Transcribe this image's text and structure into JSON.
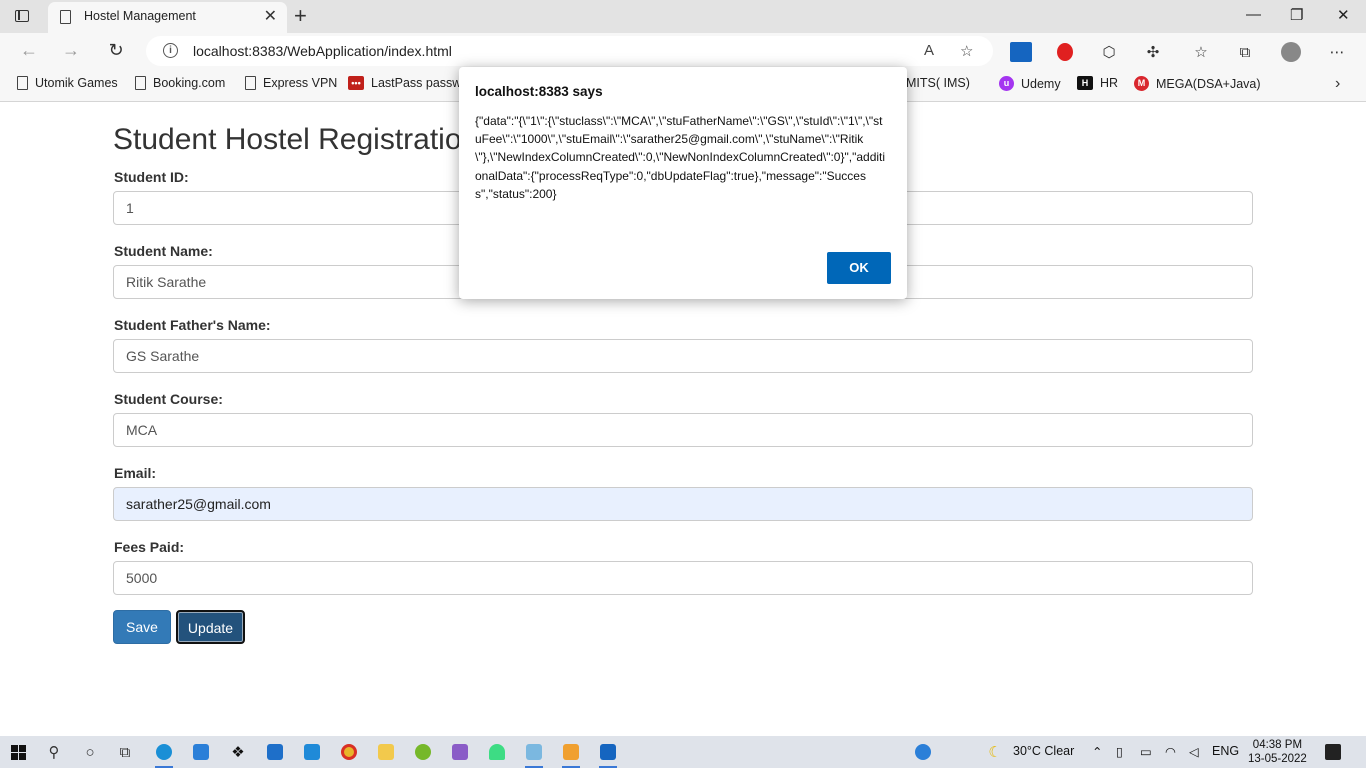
{
  "browser": {
    "tab_title": "Hostel Management",
    "url": "localhost:8383/WebApplication/index.html"
  },
  "bookmarks": [
    {
      "label": "Utomik Games"
    },
    {
      "label": "Booking.com"
    },
    {
      "label": "Express VPN"
    },
    {
      "label": "LastPass passwo"
    },
    {
      "label": "MITS( IMS)"
    },
    {
      "label": "Udemy"
    },
    {
      "label": "HR"
    },
    {
      "label": "MEGA(DSA+Java)"
    }
  ],
  "form": {
    "heading": "Student Hostel Registration",
    "student_id_label": "Student ID:",
    "student_id_value": "1",
    "student_name_label": "Student Name:",
    "student_name_value": "Ritik Sarathe",
    "father_name_label": "Student Father's Name:",
    "father_name_value": "GS Sarathe",
    "course_label": "Student Course:",
    "course_value": "MCA",
    "email_label": "Email:",
    "email_value": "sarather25@gmail.com",
    "fees_label": "Fees Paid:",
    "fees_value": "5000",
    "save_label": "Save",
    "update_label": "Update"
  },
  "dialog": {
    "title": "localhost:8383 says",
    "message": "{\"data\":\"{\\\"1\\\":{\\\"stuclass\\\":\\\"MCA\\\",\\\"stuFatherName\\\":\\\"GS\\\",\\\"stuId\\\":\\\"1\\\",\\\"stuFee\\\":\\\"1000\\\",\\\"stuEmail\\\":\\\"sarather25@gmail.com\\\",\\\"stuName\\\":\\\"Ritik\\\"},\\\"NewIndexColumnCreated\\\":0,\\\"NewNonIndexColumnCreated\\\":0}\",\"additionalData\":{\"processReqType\":0,\"dbUpdateFlag\":true},\"message\":\"Success\",\"status\":200}",
    "ok_label": "OK"
  },
  "taskbar": {
    "weather": "30°C  Clear",
    "language": "ENG",
    "time": "04:38 PM",
    "date": "13-05-2022"
  },
  "colors": {
    "accent": "#337ab7",
    "dialog_button": "#0067b8"
  }
}
